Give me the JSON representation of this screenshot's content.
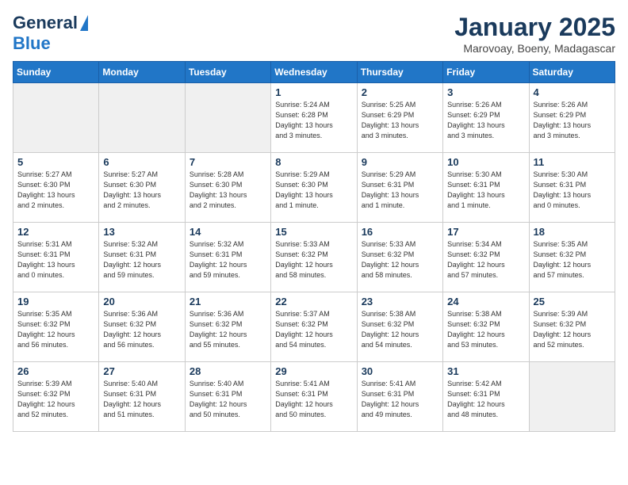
{
  "logo": {
    "line1": "General",
    "line2": "Blue"
  },
  "title": "January 2025",
  "subtitle": "Marovoay, Boeny, Madagascar",
  "days_of_week": [
    "Sunday",
    "Monday",
    "Tuesday",
    "Wednesday",
    "Thursday",
    "Friday",
    "Saturday"
  ],
  "weeks": [
    [
      {
        "day": "",
        "info": ""
      },
      {
        "day": "",
        "info": ""
      },
      {
        "day": "",
        "info": ""
      },
      {
        "day": "1",
        "info": "Sunrise: 5:24 AM\nSunset: 6:28 PM\nDaylight: 13 hours\nand 3 minutes."
      },
      {
        "day": "2",
        "info": "Sunrise: 5:25 AM\nSunset: 6:29 PM\nDaylight: 13 hours\nand 3 minutes."
      },
      {
        "day": "3",
        "info": "Sunrise: 5:26 AM\nSunset: 6:29 PM\nDaylight: 13 hours\nand 3 minutes."
      },
      {
        "day": "4",
        "info": "Sunrise: 5:26 AM\nSunset: 6:29 PM\nDaylight: 13 hours\nand 3 minutes."
      }
    ],
    [
      {
        "day": "5",
        "info": "Sunrise: 5:27 AM\nSunset: 6:30 PM\nDaylight: 13 hours\nand 2 minutes."
      },
      {
        "day": "6",
        "info": "Sunrise: 5:27 AM\nSunset: 6:30 PM\nDaylight: 13 hours\nand 2 minutes."
      },
      {
        "day": "7",
        "info": "Sunrise: 5:28 AM\nSunset: 6:30 PM\nDaylight: 13 hours\nand 2 minutes."
      },
      {
        "day": "8",
        "info": "Sunrise: 5:29 AM\nSunset: 6:30 PM\nDaylight: 13 hours\nand 1 minute."
      },
      {
        "day": "9",
        "info": "Sunrise: 5:29 AM\nSunset: 6:31 PM\nDaylight: 13 hours\nand 1 minute."
      },
      {
        "day": "10",
        "info": "Sunrise: 5:30 AM\nSunset: 6:31 PM\nDaylight: 13 hours\nand 1 minute."
      },
      {
        "day": "11",
        "info": "Sunrise: 5:30 AM\nSunset: 6:31 PM\nDaylight: 13 hours\nand 0 minutes."
      }
    ],
    [
      {
        "day": "12",
        "info": "Sunrise: 5:31 AM\nSunset: 6:31 PM\nDaylight: 13 hours\nand 0 minutes."
      },
      {
        "day": "13",
        "info": "Sunrise: 5:32 AM\nSunset: 6:31 PM\nDaylight: 12 hours\nand 59 minutes."
      },
      {
        "day": "14",
        "info": "Sunrise: 5:32 AM\nSunset: 6:31 PM\nDaylight: 12 hours\nand 59 minutes."
      },
      {
        "day": "15",
        "info": "Sunrise: 5:33 AM\nSunset: 6:32 PM\nDaylight: 12 hours\nand 58 minutes."
      },
      {
        "day": "16",
        "info": "Sunrise: 5:33 AM\nSunset: 6:32 PM\nDaylight: 12 hours\nand 58 minutes."
      },
      {
        "day": "17",
        "info": "Sunrise: 5:34 AM\nSunset: 6:32 PM\nDaylight: 12 hours\nand 57 minutes."
      },
      {
        "day": "18",
        "info": "Sunrise: 5:35 AM\nSunset: 6:32 PM\nDaylight: 12 hours\nand 57 minutes."
      }
    ],
    [
      {
        "day": "19",
        "info": "Sunrise: 5:35 AM\nSunset: 6:32 PM\nDaylight: 12 hours\nand 56 minutes."
      },
      {
        "day": "20",
        "info": "Sunrise: 5:36 AM\nSunset: 6:32 PM\nDaylight: 12 hours\nand 56 minutes."
      },
      {
        "day": "21",
        "info": "Sunrise: 5:36 AM\nSunset: 6:32 PM\nDaylight: 12 hours\nand 55 minutes."
      },
      {
        "day": "22",
        "info": "Sunrise: 5:37 AM\nSunset: 6:32 PM\nDaylight: 12 hours\nand 54 minutes."
      },
      {
        "day": "23",
        "info": "Sunrise: 5:38 AM\nSunset: 6:32 PM\nDaylight: 12 hours\nand 54 minutes."
      },
      {
        "day": "24",
        "info": "Sunrise: 5:38 AM\nSunset: 6:32 PM\nDaylight: 12 hours\nand 53 minutes."
      },
      {
        "day": "25",
        "info": "Sunrise: 5:39 AM\nSunset: 6:32 PM\nDaylight: 12 hours\nand 52 minutes."
      }
    ],
    [
      {
        "day": "26",
        "info": "Sunrise: 5:39 AM\nSunset: 6:32 PM\nDaylight: 12 hours\nand 52 minutes."
      },
      {
        "day": "27",
        "info": "Sunrise: 5:40 AM\nSunset: 6:31 PM\nDaylight: 12 hours\nand 51 minutes."
      },
      {
        "day": "28",
        "info": "Sunrise: 5:40 AM\nSunset: 6:31 PM\nDaylight: 12 hours\nand 50 minutes."
      },
      {
        "day": "29",
        "info": "Sunrise: 5:41 AM\nSunset: 6:31 PM\nDaylight: 12 hours\nand 50 minutes."
      },
      {
        "day": "30",
        "info": "Sunrise: 5:41 AM\nSunset: 6:31 PM\nDaylight: 12 hours\nand 49 minutes."
      },
      {
        "day": "31",
        "info": "Sunrise: 5:42 AM\nSunset: 6:31 PM\nDaylight: 12 hours\nand 48 minutes."
      },
      {
        "day": "",
        "info": ""
      }
    ]
  ]
}
